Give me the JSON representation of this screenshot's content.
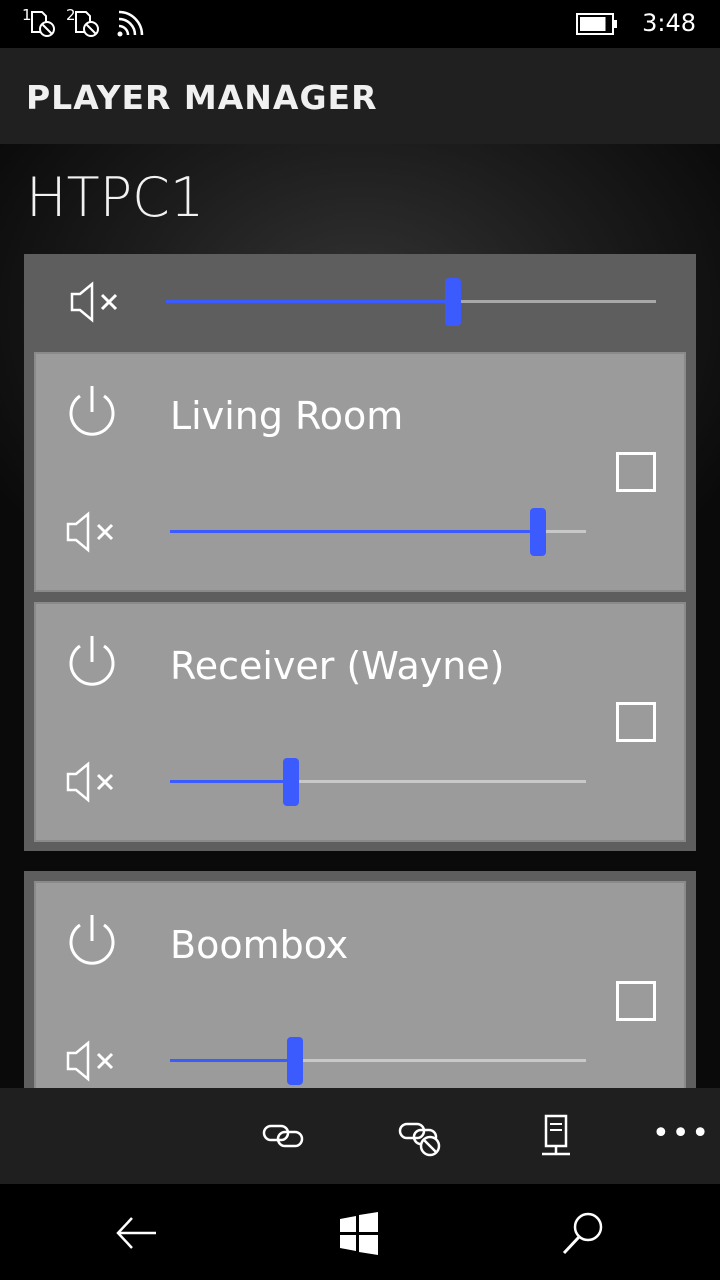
{
  "status_bar": {
    "sim1_label": "1",
    "sim2_label": "2",
    "time": "3:48",
    "battery_level": 0.85,
    "icons": [
      "sim-no-service-icon",
      "sim-no-service-icon",
      "wifi-icon",
      "battery-icon"
    ]
  },
  "app": {
    "title": "PLAYER MANAGER"
  },
  "server": {
    "name": "HTPC1"
  },
  "groups": [
    {
      "master_volume": 0.585,
      "players": [
        {
          "name": "Living Room",
          "volume": 0.885,
          "selected": false
        },
        {
          "name": "Receiver (Wayne)",
          "volume": 0.29,
          "selected": false
        }
      ]
    },
    {
      "players": [
        {
          "name": "Boombox",
          "volume": 0.3,
          "selected": false
        }
      ]
    }
  ],
  "command_bar": {
    "buttons": [
      "link-icon",
      "unlink-icon",
      "server-icon"
    ],
    "more_label": "•••"
  },
  "nav_bar": {
    "buttons": [
      "back-arrow-icon",
      "windows-start-icon",
      "search-icon"
    ]
  },
  "colors": {
    "accent": "#3b5bff",
    "card": "#9b9b9b",
    "group": "#5e5e5e",
    "title_bar": "#202020"
  }
}
